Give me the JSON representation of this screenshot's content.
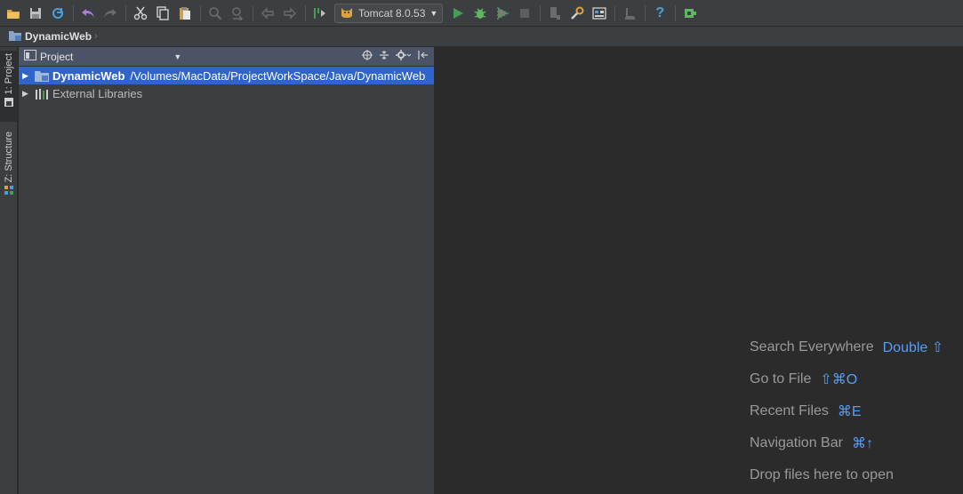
{
  "toolbar": {
    "run_config_label": "Tomcat 8.0.53",
    "accent_run": "#499c54",
    "help_label": "?"
  },
  "navbar": {
    "crumb": "DynamicWeb"
  },
  "side_tabs": [
    {
      "label": "1: Project"
    },
    {
      "label": "Z: Structure"
    }
  ],
  "project_panel": {
    "title": "Project",
    "tree": [
      {
        "name": "DynamicWeb",
        "path": "/Volumes/MacData/ProjectWorkSpace/Java/DynamicWeb",
        "selected": true
      },
      {
        "name": "External Libraries",
        "selected": false
      }
    ]
  },
  "editor_hints": [
    {
      "label": "Search Everywhere",
      "key": "Double ⇧"
    },
    {
      "label": "Go to File",
      "key": "⇧⌘O"
    },
    {
      "label": "Recent Files",
      "key": "⌘E"
    },
    {
      "label": "Navigation Bar",
      "key": "⌘↑"
    },
    {
      "label": "Drop files here to open",
      "key": ""
    }
  ]
}
